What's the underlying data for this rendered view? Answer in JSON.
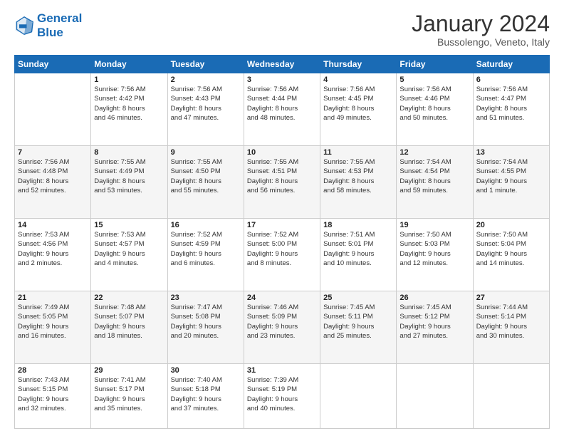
{
  "header": {
    "logo_line1": "General",
    "logo_line2": "Blue",
    "title": "January 2024",
    "subtitle": "Bussolengo, Veneto, Italy"
  },
  "weekdays": [
    "Sunday",
    "Monday",
    "Tuesday",
    "Wednesday",
    "Thursday",
    "Friday",
    "Saturday"
  ],
  "weeks": [
    [
      {
        "day": "",
        "info": ""
      },
      {
        "day": "1",
        "info": "Sunrise: 7:56 AM\nSunset: 4:42 PM\nDaylight: 8 hours\nand 46 minutes."
      },
      {
        "day": "2",
        "info": "Sunrise: 7:56 AM\nSunset: 4:43 PM\nDaylight: 8 hours\nand 47 minutes."
      },
      {
        "day": "3",
        "info": "Sunrise: 7:56 AM\nSunset: 4:44 PM\nDaylight: 8 hours\nand 48 minutes."
      },
      {
        "day": "4",
        "info": "Sunrise: 7:56 AM\nSunset: 4:45 PM\nDaylight: 8 hours\nand 49 minutes."
      },
      {
        "day": "5",
        "info": "Sunrise: 7:56 AM\nSunset: 4:46 PM\nDaylight: 8 hours\nand 50 minutes."
      },
      {
        "day": "6",
        "info": "Sunrise: 7:56 AM\nSunset: 4:47 PM\nDaylight: 8 hours\nand 51 minutes."
      }
    ],
    [
      {
        "day": "7",
        "info": "Sunrise: 7:56 AM\nSunset: 4:48 PM\nDaylight: 8 hours\nand 52 minutes."
      },
      {
        "day": "8",
        "info": "Sunrise: 7:55 AM\nSunset: 4:49 PM\nDaylight: 8 hours\nand 53 minutes."
      },
      {
        "day": "9",
        "info": "Sunrise: 7:55 AM\nSunset: 4:50 PM\nDaylight: 8 hours\nand 55 minutes."
      },
      {
        "day": "10",
        "info": "Sunrise: 7:55 AM\nSunset: 4:51 PM\nDaylight: 8 hours\nand 56 minutes."
      },
      {
        "day": "11",
        "info": "Sunrise: 7:55 AM\nSunset: 4:53 PM\nDaylight: 8 hours\nand 58 minutes."
      },
      {
        "day": "12",
        "info": "Sunrise: 7:54 AM\nSunset: 4:54 PM\nDaylight: 8 hours\nand 59 minutes."
      },
      {
        "day": "13",
        "info": "Sunrise: 7:54 AM\nSunset: 4:55 PM\nDaylight: 9 hours\nand 1 minute."
      }
    ],
    [
      {
        "day": "14",
        "info": "Sunrise: 7:53 AM\nSunset: 4:56 PM\nDaylight: 9 hours\nand 2 minutes."
      },
      {
        "day": "15",
        "info": "Sunrise: 7:53 AM\nSunset: 4:57 PM\nDaylight: 9 hours\nand 4 minutes."
      },
      {
        "day": "16",
        "info": "Sunrise: 7:52 AM\nSunset: 4:59 PM\nDaylight: 9 hours\nand 6 minutes."
      },
      {
        "day": "17",
        "info": "Sunrise: 7:52 AM\nSunset: 5:00 PM\nDaylight: 9 hours\nand 8 minutes."
      },
      {
        "day": "18",
        "info": "Sunrise: 7:51 AM\nSunset: 5:01 PM\nDaylight: 9 hours\nand 10 minutes."
      },
      {
        "day": "19",
        "info": "Sunrise: 7:50 AM\nSunset: 5:03 PM\nDaylight: 9 hours\nand 12 minutes."
      },
      {
        "day": "20",
        "info": "Sunrise: 7:50 AM\nSunset: 5:04 PM\nDaylight: 9 hours\nand 14 minutes."
      }
    ],
    [
      {
        "day": "21",
        "info": "Sunrise: 7:49 AM\nSunset: 5:05 PM\nDaylight: 9 hours\nand 16 minutes."
      },
      {
        "day": "22",
        "info": "Sunrise: 7:48 AM\nSunset: 5:07 PM\nDaylight: 9 hours\nand 18 minutes."
      },
      {
        "day": "23",
        "info": "Sunrise: 7:47 AM\nSunset: 5:08 PM\nDaylight: 9 hours\nand 20 minutes."
      },
      {
        "day": "24",
        "info": "Sunrise: 7:46 AM\nSunset: 5:09 PM\nDaylight: 9 hours\nand 23 minutes."
      },
      {
        "day": "25",
        "info": "Sunrise: 7:45 AM\nSunset: 5:11 PM\nDaylight: 9 hours\nand 25 minutes."
      },
      {
        "day": "26",
        "info": "Sunrise: 7:45 AM\nSunset: 5:12 PM\nDaylight: 9 hours\nand 27 minutes."
      },
      {
        "day": "27",
        "info": "Sunrise: 7:44 AM\nSunset: 5:14 PM\nDaylight: 9 hours\nand 30 minutes."
      }
    ],
    [
      {
        "day": "28",
        "info": "Sunrise: 7:43 AM\nSunset: 5:15 PM\nDaylight: 9 hours\nand 32 minutes."
      },
      {
        "day": "29",
        "info": "Sunrise: 7:41 AM\nSunset: 5:17 PM\nDaylight: 9 hours\nand 35 minutes."
      },
      {
        "day": "30",
        "info": "Sunrise: 7:40 AM\nSunset: 5:18 PM\nDaylight: 9 hours\nand 37 minutes."
      },
      {
        "day": "31",
        "info": "Sunrise: 7:39 AM\nSunset: 5:19 PM\nDaylight: 9 hours\nand 40 minutes."
      },
      {
        "day": "",
        "info": ""
      },
      {
        "day": "",
        "info": ""
      },
      {
        "day": "",
        "info": ""
      }
    ]
  ]
}
